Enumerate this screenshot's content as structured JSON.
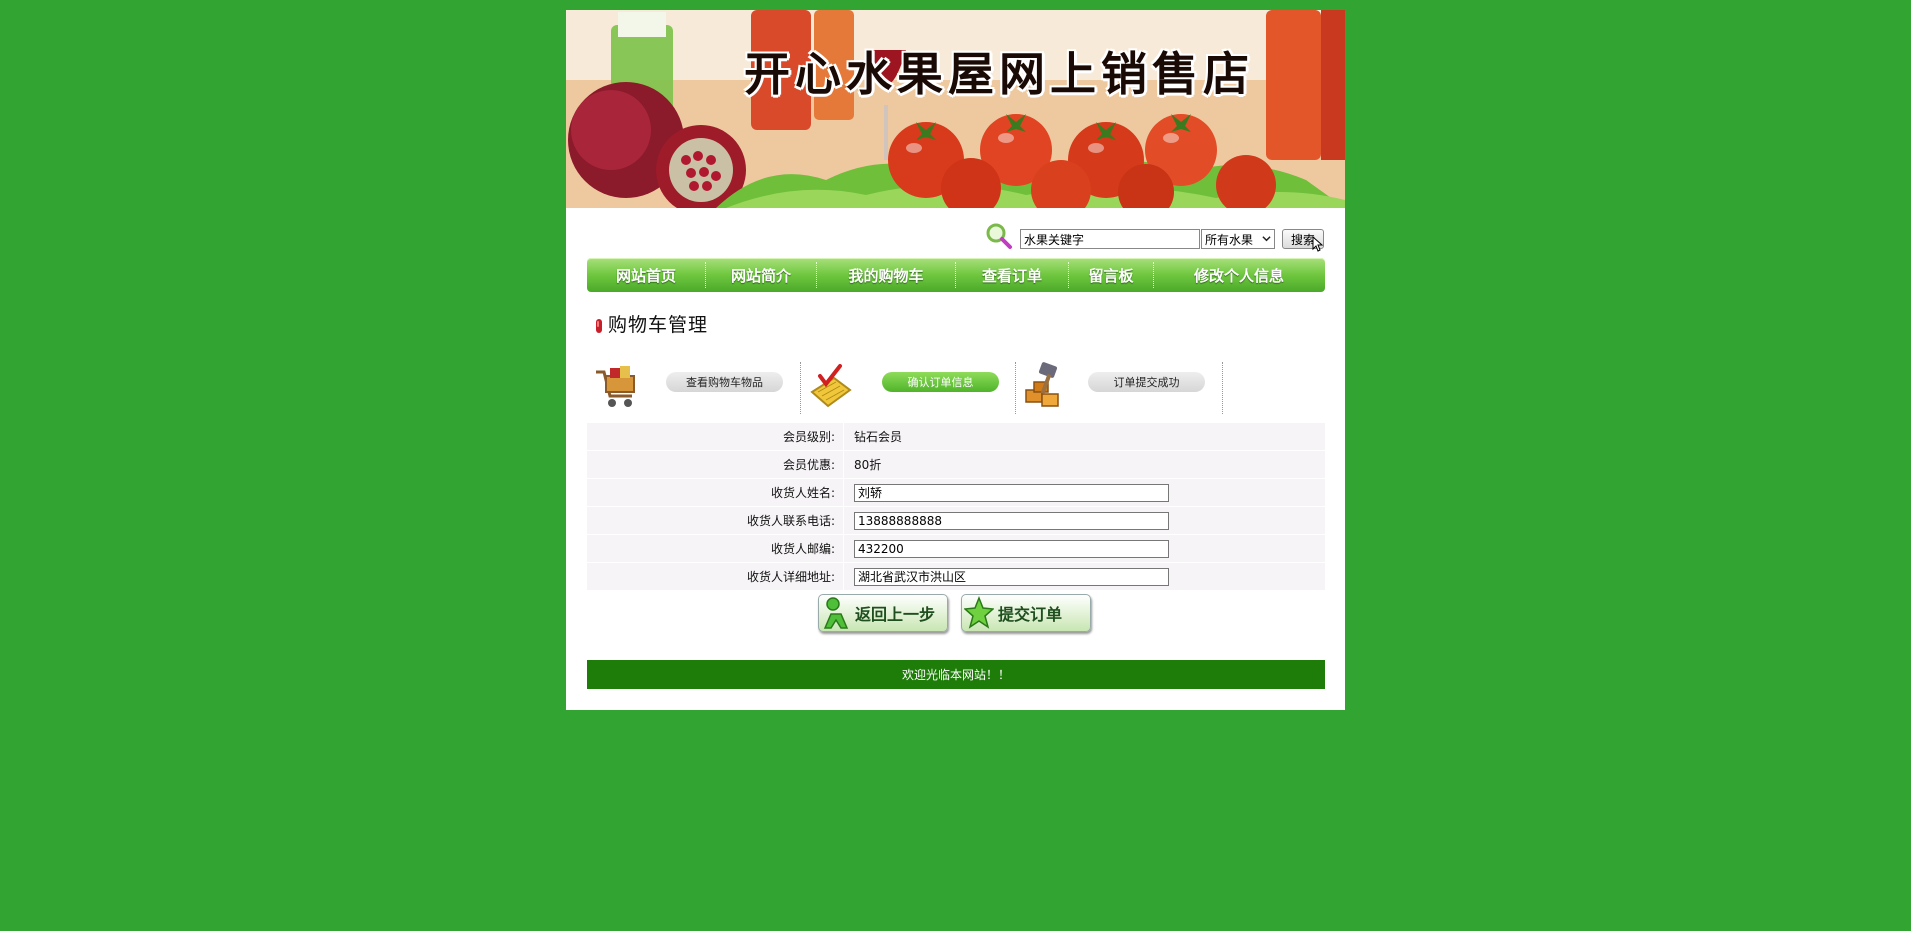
{
  "banner": {
    "title": "开心水果屋网上销售店"
  },
  "search": {
    "value": "水果关键字",
    "category_selected": "所有水果",
    "button_label": "搜索"
  },
  "nav": {
    "items": [
      {
        "label": "网站首页"
      },
      {
        "label": "网站简介"
      },
      {
        "label": "我的购物车"
      },
      {
        "label": "查看订单"
      },
      {
        "label": "留言板"
      },
      {
        "label": "修改个人信息"
      }
    ]
  },
  "section": {
    "title": "购物车管理"
  },
  "steps": [
    {
      "label": "查看购物车物品",
      "active": false
    },
    {
      "label": "确认订单信息",
      "active": true
    },
    {
      "label": "订单提交成功",
      "active": false
    }
  ],
  "form": {
    "member_level_label": "会员级别:",
    "member_level_value": "钻石会员",
    "discount_label": "会员优惠:",
    "discount_value": "80折",
    "name_label": "收货人姓名:",
    "name_value": "刘轿",
    "phone_label": "收货人联系电话:",
    "phone_value": "13888888888",
    "zip_label": "收货人邮编:",
    "zip_value": "432200",
    "address_label": "收货人详细地址:",
    "address_value": "湖北省武汉市洪山区"
  },
  "actions": {
    "back_label": "返回上一步",
    "submit_label": "提交订单"
  },
  "footer": {
    "text": "欢迎光临本网站！！"
  },
  "colors": {
    "page_background": "#32a432",
    "nav_green": "#6fc73e",
    "footer_green": "#1e7c08",
    "active_step": "#4fb42a"
  }
}
